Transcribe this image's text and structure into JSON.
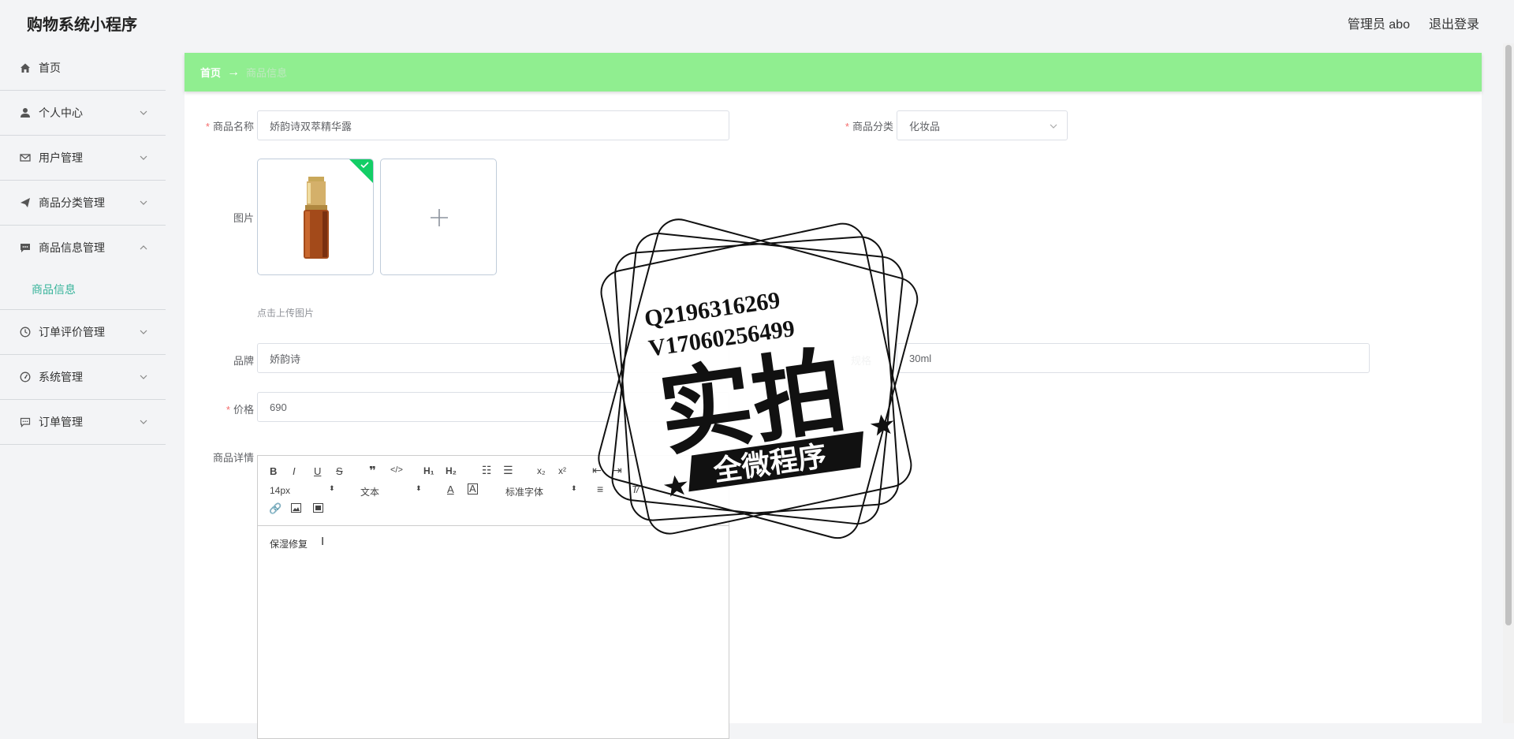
{
  "app": {
    "title": "购物系统小程序"
  },
  "header": {
    "user": "管理员 abo",
    "logout": "退出登录"
  },
  "sidebar": {
    "items": [
      {
        "label": "首页",
        "icon": "home-icon"
      },
      {
        "label": "个人中心",
        "icon": "user-icon"
      },
      {
        "label": "用户管理",
        "icon": "mail-icon"
      },
      {
        "label": "商品分类管理",
        "icon": "send-icon"
      },
      {
        "label": "商品信息管理",
        "icon": "chat-icon",
        "open": true,
        "children": [
          "商品信息"
        ]
      },
      {
        "label": "订单评价管理",
        "icon": "clock-icon"
      },
      {
        "label": "系统管理",
        "icon": "gauge-icon"
      },
      {
        "label": "订单管理",
        "icon": "comment-icon"
      }
    ]
  },
  "breadcrumb": {
    "home": "首页",
    "current": "商品信息"
  },
  "form": {
    "name_label": "商品名称",
    "name_value": "娇韵诗双萃精华露",
    "category_label": "商品分类",
    "category_value": "化妆品",
    "image_label": "图片",
    "upload_hint": "点击上传图片",
    "brand_label": "品牌",
    "brand_value": "娇韵诗",
    "spec_label": "规格",
    "spec_value": "30ml",
    "price_label": "价格",
    "price_value": "690",
    "detail_label": "商品详情",
    "detail_content": "保湿修复"
  },
  "editor": {
    "font_size": "14px",
    "text_type": "文本",
    "font_family": "标准字体"
  },
  "watermark": {
    "line1": "Q2196316269",
    "line2": "V17060256499",
    "big": "实拍",
    "banner": "全微程序"
  },
  "colors": {
    "accent": "#36b39a",
    "breadcrumb_bg": "#90ee90",
    "required": "#f56c6c"
  }
}
